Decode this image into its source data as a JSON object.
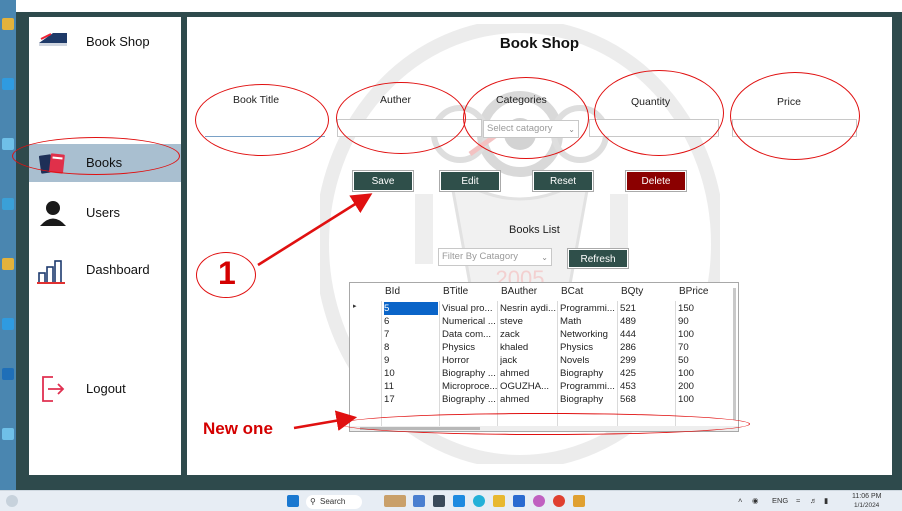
{
  "app": {
    "brand": "Book Shop",
    "page_title": "Book Shop"
  },
  "sidebar": {
    "items": [
      {
        "label": "Books",
        "icon": "books-icon",
        "active": true
      },
      {
        "label": "Users",
        "icon": "user-icon",
        "active": false
      },
      {
        "label": "Dashboard",
        "icon": "bar-chart-icon",
        "active": false
      },
      {
        "label": "Logout",
        "icon": "logout-icon",
        "active": false
      }
    ]
  },
  "form": {
    "labels": {
      "title": "Book Title",
      "author": "Auther",
      "category": "Categories",
      "quantity": "Quantity",
      "price": "Price"
    },
    "values": {
      "title": "",
      "author": "",
      "quantity": "",
      "price": ""
    },
    "category_select": "Select catagory"
  },
  "buttons": {
    "save": "Save",
    "edit": "Edit",
    "reset": "Reset",
    "delete": "Delete",
    "refresh": "Refresh"
  },
  "list": {
    "title": "Books List",
    "filter_placeholder": "Filter By Catagory"
  },
  "table": {
    "columns": [
      "BId",
      "BTitle",
      "BAuther",
      "BCat",
      "BQty",
      "BPrice"
    ],
    "rows": [
      [
        "5",
        "Visual pro...",
        "Nesrin aydi...",
        "Programmi...",
        "521",
        "150"
      ],
      [
        "6",
        "Numerical ...",
        "steve",
        "Math",
        "489",
        "90"
      ],
      [
        "7",
        "Data com...",
        "zack",
        "Networking",
        "444",
        "100"
      ],
      [
        "8",
        "Physics",
        "khaled",
        "Physics",
        "286",
        "70"
      ],
      [
        "9",
        "Horror",
        "jack",
        "Novels",
        "299",
        "50"
      ],
      [
        "10",
        "Biography ...",
        "ahmed",
        "Biography",
        "425",
        "100"
      ],
      [
        "11",
        "Microproce...",
        "OGUZHA...",
        "Programmi...",
        "453",
        "200"
      ],
      [
        "17",
        "Biography ...",
        "ahmed",
        "Biography",
        "568",
        "100"
      ]
    ]
  },
  "watermark": {
    "year": "2005"
  },
  "annotations": {
    "step": "1",
    "new_label": "New one"
  },
  "taskbar": {
    "search": "Search",
    "lang": "ENG",
    "time": "11:06 PM",
    "date": "1/1/2024"
  },
  "colors": {
    "frame": "#2e4a4c",
    "active_nav": "#a9bfd0",
    "button_dark": "#2f4f4a",
    "button_delete": "#8b0000",
    "annotation": "#e01010",
    "selection": "#0a64c8"
  }
}
